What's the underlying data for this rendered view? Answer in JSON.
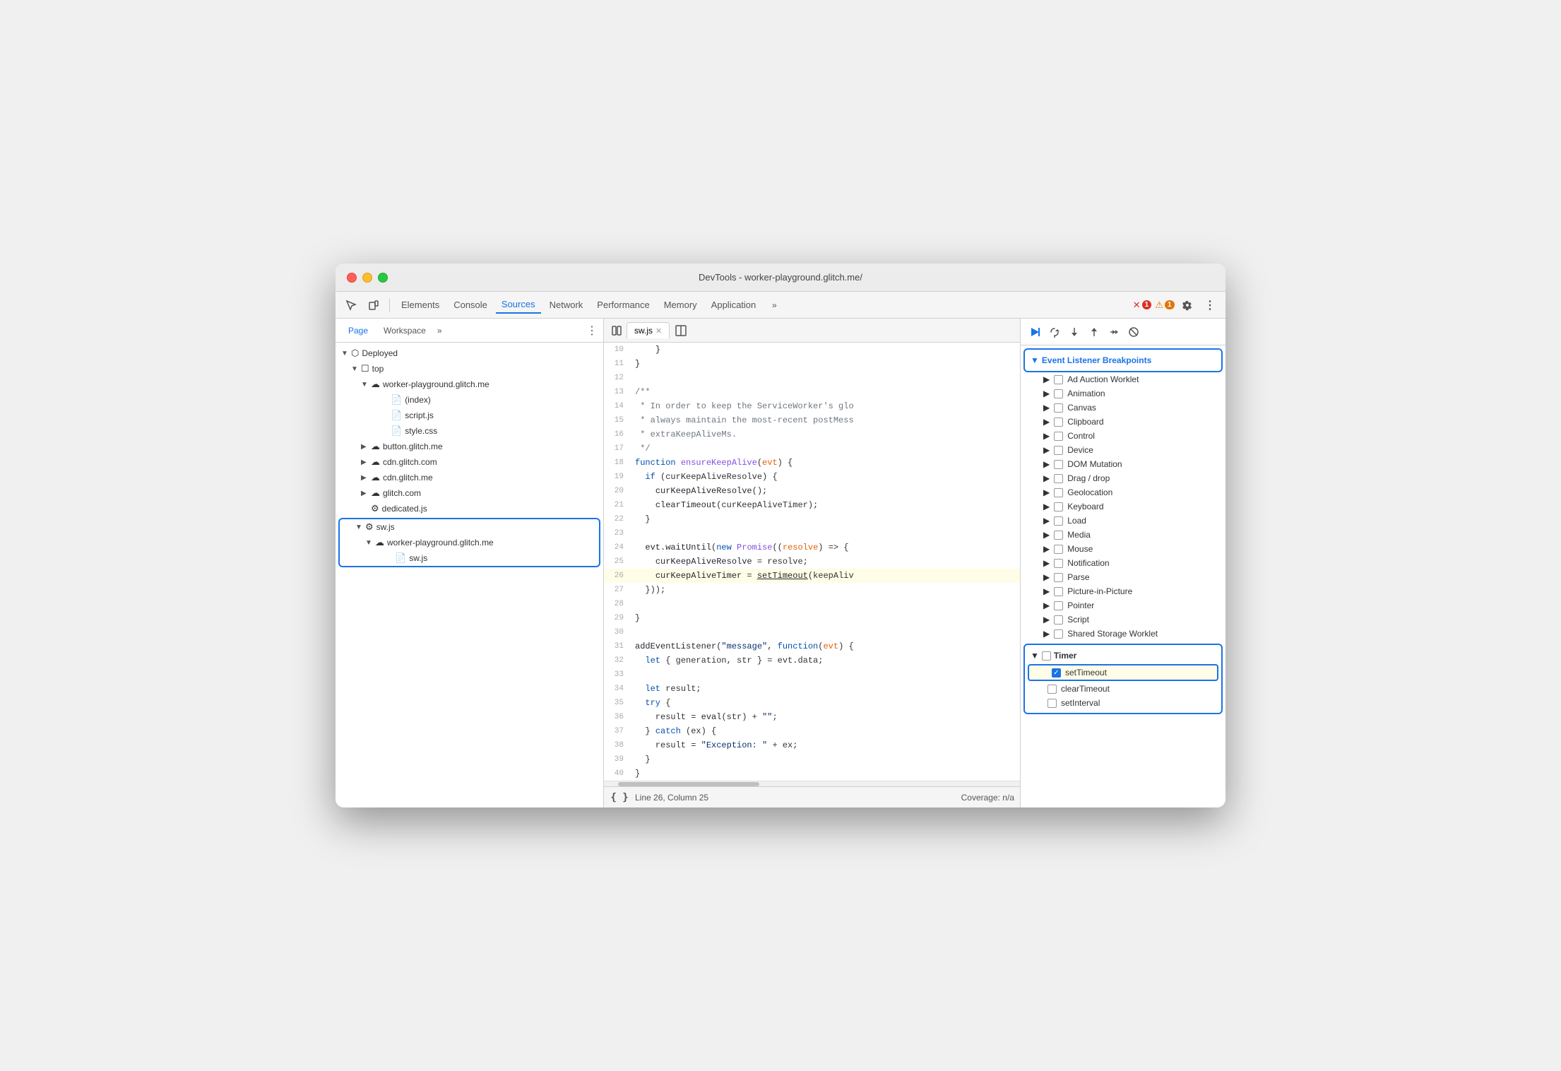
{
  "window": {
    "title": "DevTools - worker-playground.glitch.me/"
  },
  "toolbar": {
    "tabs": [
      {
        "label": "Elements",
        "active": false
      },
      {
        "label": "Console",
        "active": false
      },
      {
        "label": "Sources",
        "active": true
      },
      {
        "label": "Network",
        "active": false
      },
      {
        "label": "Performance",
        "active": false
      },
      {
        "label": "Memory",
        "active": false
      },
      {
        "label": "Application",
        "active": false
      }
    ],
    "error_count": "1",
    "warn_count": "1"
  },
  "left_panel": {
    "tabs": [
      "Page",
      "Workspace"
    ],
    "active_tab": "Page",
    "tree": [
      {
        "id": "deployed",
        "label": "Deployed",
        "indent": 0,
        "type": "folder",
        "expanded": true
      },
      {
        "id": "top",
        "label": "top",
        "indent": 1,
        "type": "folder",
        "expanded": true
      },
      {
        "id": "worker-playground-glitch",
        "label": "worker-playground.glitch.me",
        "indent": 2,
        "type": "cloud",
        "expanded": true
      },
      {
        "id": "index",
        "label": "(index)",
        "indent": 3,
        "type": "file"
      },
      {
        "id": "scriptjs",
        "label": "script.js",
        "indent": 3,
        "type": "file-js"
      },
      {
        "id": "stylecss",
        "label": "style.css",
        "indent": 3,
        "type": "file-css"
      },
      {
        "id": "button-glitch",
        "label": "button.glitch.me",
        "indent": 2,
        "type": "cloud",
        "expanded": false
      },
      {
        "id": "cdn-glitch-com",
        "label": "cdn.glitch.com",
        "indent": 2,
        "type": "cloud",
        "expanded": false
      },
      {
        "id": "cdn-glitch-me",
        "label": "cdn.glitch.me",
        "indent": 2,
        "type": "cloud",
        "expanded": false
      },
      {
        "id": "glitch-com",
        "label": "glitch.com",
        "indent": 2,
        "type": "cloud",
        "expanded": false
      },
      {
        "id": "dedicatedjs",
        "label": "dedicated.js",
        "indent": 2,
        "type": "file-gear"
      },
      {
        "id": "swjs-parent",
        "label": "sw.js",
        "indent": 2,
        "type": "file-gear",
        "expanded": true,
        "highlighted": true
      },
      {
        "id": "worker-playground2",
        "label": "worker-playground.glitch.me",
        "indent": 3,
        "type": "cloud",
        "expanded": true,
        "highlighted": true
      },
      {
        "id": "swjs-child",
        "label": "sw.js",
        "indent": 4,
        "type": "file-js",
        "highlighted": true
      }
    ]
  },
  "editor": {
    "file_name": "sw.js",
    "lines": [
      {
        "num": 10,
        "text": "    }"
      },
      {
        "num": 11,
        "text": "}"
      },
      {
        "num": 12,
        "text": ""
      },
      {
        "num": 13,
        "text": "/**"
      },
      {
        "num": 14,
        "text": " * In order to keep the ServiceWorker's glo"
      },
      {
        "num": 15,
        "text": " * always maintain the most-recent postMess"
      },
      {
        "num": 16,
        "text": " * extraKeepAliveMs."
      },
      {
        "num": 17,
        "text": " */"
      },
      {
        "num": 18,
        "text": "function ensureKeepAlive(evt) {"
      },
      {
        "num": 19,
        "text": "  if (curKeepAliveResolve) {"
      },
      {
        "num": 20,
        "text": "    curKeepAliveResolve();"
      },
      {
        "num": 21,
        "text": "    clearTimeout(curKeepAliveTimer);"
      },
      {
        "num": 22,
        "text": "  }"
      },
      {
        "num": 23,
        "text": ""
      },
      {
        "num": 24,
        "text": "  evt.waitUntil(new Promise((resolve) => {"
      },
      {
        "num": 25,
        "text": "    curKeepAliveResolve = resolve;"
      },
      {
        "num": 26,
        "text": "    curKeepAliveTimer = setTimeout(keepAliv",
        "highlighted": true
      },
      {
        "num": 27,
        "text": "  }));"
      },
      {
        "num": 28,
        "text": ""
      },
      {
        "num": 29,
        "text": "}"
      },
      {
        "num": 30,
        "text": ""
      },
      {
        "num": 31,
        "text": "addEventListener(\"message\", function(evt) {"
      },
      {
        "num": 32,
        "text": "  let { generation, str } = evt.data;"
      },
      {
        "num": 33,
        "text": ""
      },
      {
        "num": 34,
        "text": "  let result;"
      },
      {
        "num": 35,
        "text": "  try {"
      },
      {
        "num": 36,
        "text": "    result = eval(str) + \"\";"
      },
      {
        "num": 37,
        "text": "  } catch (ex) {"
      },
      {
        "num": 38,
        "text": "    result = \"Exception: \" + ex;"
      },
      {
        "num": 39,
        "text": "  }"
      },
      {
        "num": 40,
        "text": "}"
      }
    ],
    "status": {
      "format_btn": "{ }",
      "position": "Line 26, Column 25",
      "coverage": "Coverage: n/a"
    }
  },
  "right_panel": {
    "elb_title": "Event Listener Breakpoints",
    "breakpoint_groups": [
      {
        "label": "Ad Auction Worklet",
        "expanded": false
      },
      {
        "label": "Animation",
        "expanded": false
      },
      {
        "label": "Canvas",
        "expanded": false
      },
      {
        "label": "Clipboard",
        "expanded": false
      },
      {
        "label": "Control",
        "expanded": false
      },
      {
        "label": "Device",
        "expanded": false
      },
      {
        "label": "DOM Mutation",
        "expanded": false
      },
      {
        "label": "Drag / drop",
        "expanded": false
      },
      {
        "label": "Geolocation",
        "expanded": false
      },
      {
        "label": "Keyboard",
        "expanded": false
      },
      {
        "label": "Load",
        "expanded": false
      },
      {
        "label": "Media",
        "expanded": false
      },
      {
        "label": "Mouse",
        "expanded": false
      },
      {
        "label": "Notification",
        "expanded": false
      },
      {
        "label": "Parse",
        "expanded": false
      },
      {
        "label": "Picture-in-Picture",
        "expanded": false
      },
      {
        "label": "Pointer",
        "expanded": false
      },
      {
        "label": "Script",
        "expanded": false
      },
      {
        "label": "Shared Storage Worklet",
        "expanded": false
      }
    ],
    "timer_group": {
      "label": "Timer",
      "expanded": true,
      "items": [
        {
          "label": "setTimeout",
          "checked": true
        },
        {
          "label": "clearTimeout",
          "checked": false
        },
        {
          "label": "setInterval",
          "checked": false
        }
      ]
    }
  }
}
